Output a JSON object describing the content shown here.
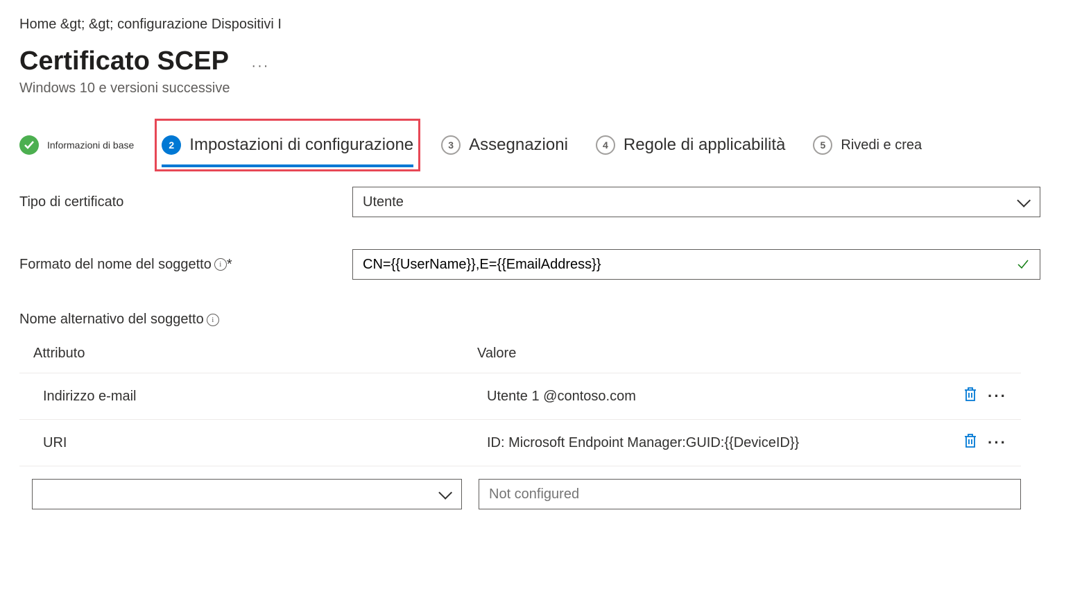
{
  "breadcrumb": "Home &gt;  &gt; configurazione Dispositivi I",
  "page_title": "Certificato SCEP",
  "subtitle": "Windows 10 e versioni successive",
  "wizard": {
    "step1": {
      "label": "Informazioni di base"
    },
    "step2": {
      "num": "2",
      "label": "Impostazioni di configurazione"
    },
    "step3": {
      "num": "3",
      "label": "Assegnazioni"
    },
    "step4": {
      "num": "4",
      "label": "Regole di applicabilità"
    },
    "step5": {
      "num": "5",
      "label": "Rivedi e crea"
    }
  },
  "form": {
    "cert_type_label": "Tipo di certificato",
    "cert_type_value": "Utente",
    "subject_format_label": "Formato del nome del soggetto",
    "subject_format_value": "CN={{UserName}},E={{EmailAddress}}"
  },
  "san": {
    "title": "Nome alternativo del soggetto",
    "col_attr": "Attributo",
    "col_val": "Valore",
    "rows": [
      {
        "attr": "Indirizzo e-mail",
        "val": "Utente 1 @contoso.com"
      },
      {
        "attr": "URI",
        "val": "ID: Microsoft Endpoint Manager:GUID:{{DeviceID}}"
      }
    ],
    "add_placeholder": "Not configured"
  }
}
